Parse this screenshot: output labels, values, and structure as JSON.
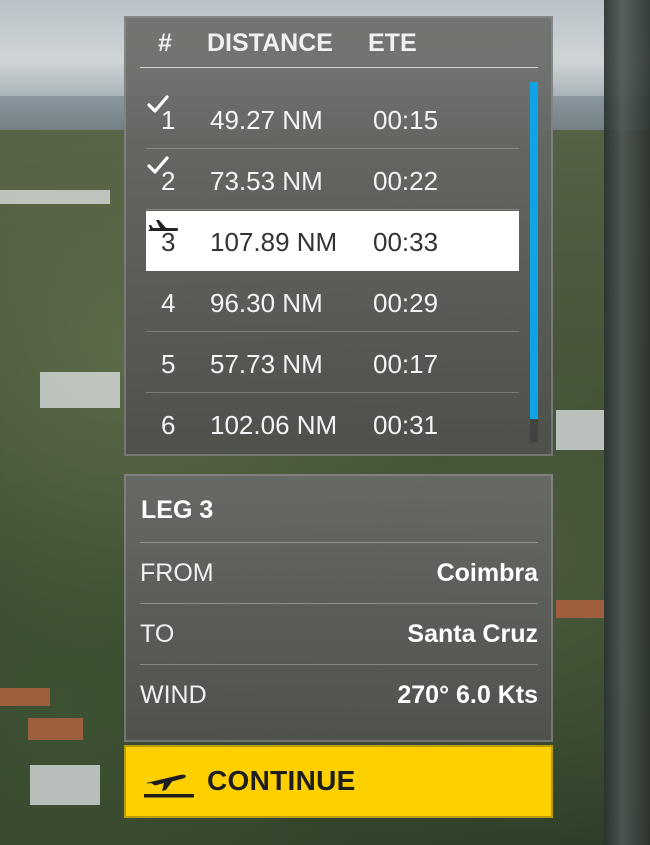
{
  "table": {
    "headers": {
      "num": "#",
      "distance": "DISTANCE",
      "ete": "ETE"
    },
    "rows": [
      {
        "num": "1",
        "distance": "49.27 NM",
        "ete": "00:15",
        "status_icon": "check-icon"
      },
      {
        "num": "2",
        "distance": "73.53 NM",
        "ete": "00:22",
        "status_icon": "check-icon"
      },
      {
        "num": "3",
        "distance": "107.89 NM",
        "ete": "00:33",
        "status_icon": "airplane-icon",
        "selected": true
      },
      {
        "num": "4",
        "distance": "96.30 NM",
        "ete": "00:29"
      },
      {
        "num": "5",
        "distance": "57.73 NM",
        "ete": "00:17"
      },
      {
        "num": "6",
        "distance": "102.06 NM",
        "ete": "00:31"
      }
    ]
  },
  "leg": {
    "title": "LEG 3",
    "from_label": "FROM",
    "from_value": "Coimbra",
    "to_label": "TO",
    "to_value": "Santa Cruz",
    "wind_label": "WIND",
    "wind_value": "270° 6.0 Kts"
  },
  "continue": {
    "label": "CONTINUE",
    "icon": "takeoff-icon"
  },
  "colors": {
    "accent_yellow": "#ffd000",
    "scrollbar_blue": "#10a3e8",
    "panel_gray": "#5a5c58",
    "selected_row": "#ffffff"
  }
}
